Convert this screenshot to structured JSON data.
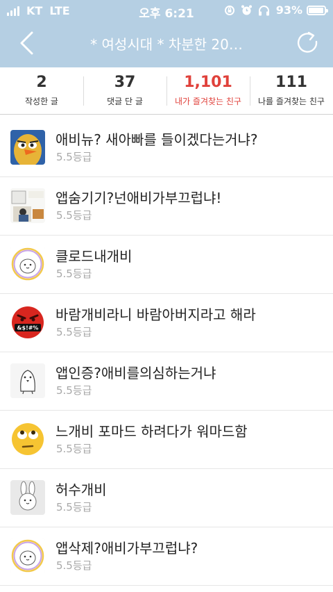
{
  "status_bar": {
    "carrier": "KT",
    "network": "LTE",
    "time": "오후 6:21",
    "battery": "93%",
    "icons": [
      "signal-icon",
      "orientation-lock-icon",
      "alarm-icon",
      "headphones-icon",
      "battery-icon"
    ]
  },
  "header": {
    "title": "* 여성시대 *  차분한 20…",
    "back_icon": "chevron-left-icon",
    "refresh_icon": "refresh-icon",
    "background_color": "#b5cfe3"
  },
  "stats": [
    {
      "value": "2",
      "label": "작성한 글"
    },
    {
      "value": "37",
      "label": "댓글 단 글"
    },
    {
      "value": "1,101",
      "label": "내가 즐겨찾는 친구",
      "active": true
    },
    {
      "value": "111",
      "label": "나를 즐겨찾는 친구"
    }
  ],
  "accent_color": "#e0413b",
  "items": [
    {
      "title": "애비뉴? 새아빠를 들이겠다는거냐?",
      "grade": "5.5등급",
      "avatar": "bald-man-cartoon-avatar"
    },
    {
      "title": "앱숨기기?넌애비가부끄럽냐!",
      "grade": "5.5등급",
      "avatar": "comic-panel-avatar"
    },
    {
      "title": "클로드내개비",
      "grade": "5.5등급",
      "avatar": "rainbow-ring-character-avatar"
    },
    {
      "title": "바람개비라니 바람아버지라고 해라",
      "grade": "5.5등급",
      "avatar": "angry-cursing-emoji-avatar"
    },
    {
      "title": "앱인증?애비를의심하는거냐",
      "grade": "5.5등급",
      "avatar": "penguin-character-avatar"
    },
    {
      "title": "느개비 포마드 하려다가 워마드함",
      "grade": "5.5등급",
      "avatar": "eye-roll-emoji-avatar"
    },
    {
      "title": "허수개비",
      "grade": "5.5등급",
      "avatar": "bunny-character-avatar"
    },
    {
      "title": "앱삭제?애비가부끄럽냐?",
      "grade": "5.5등급",
      "avatar": "rainbow-ring-character-avatar"
    }
  ]
}
